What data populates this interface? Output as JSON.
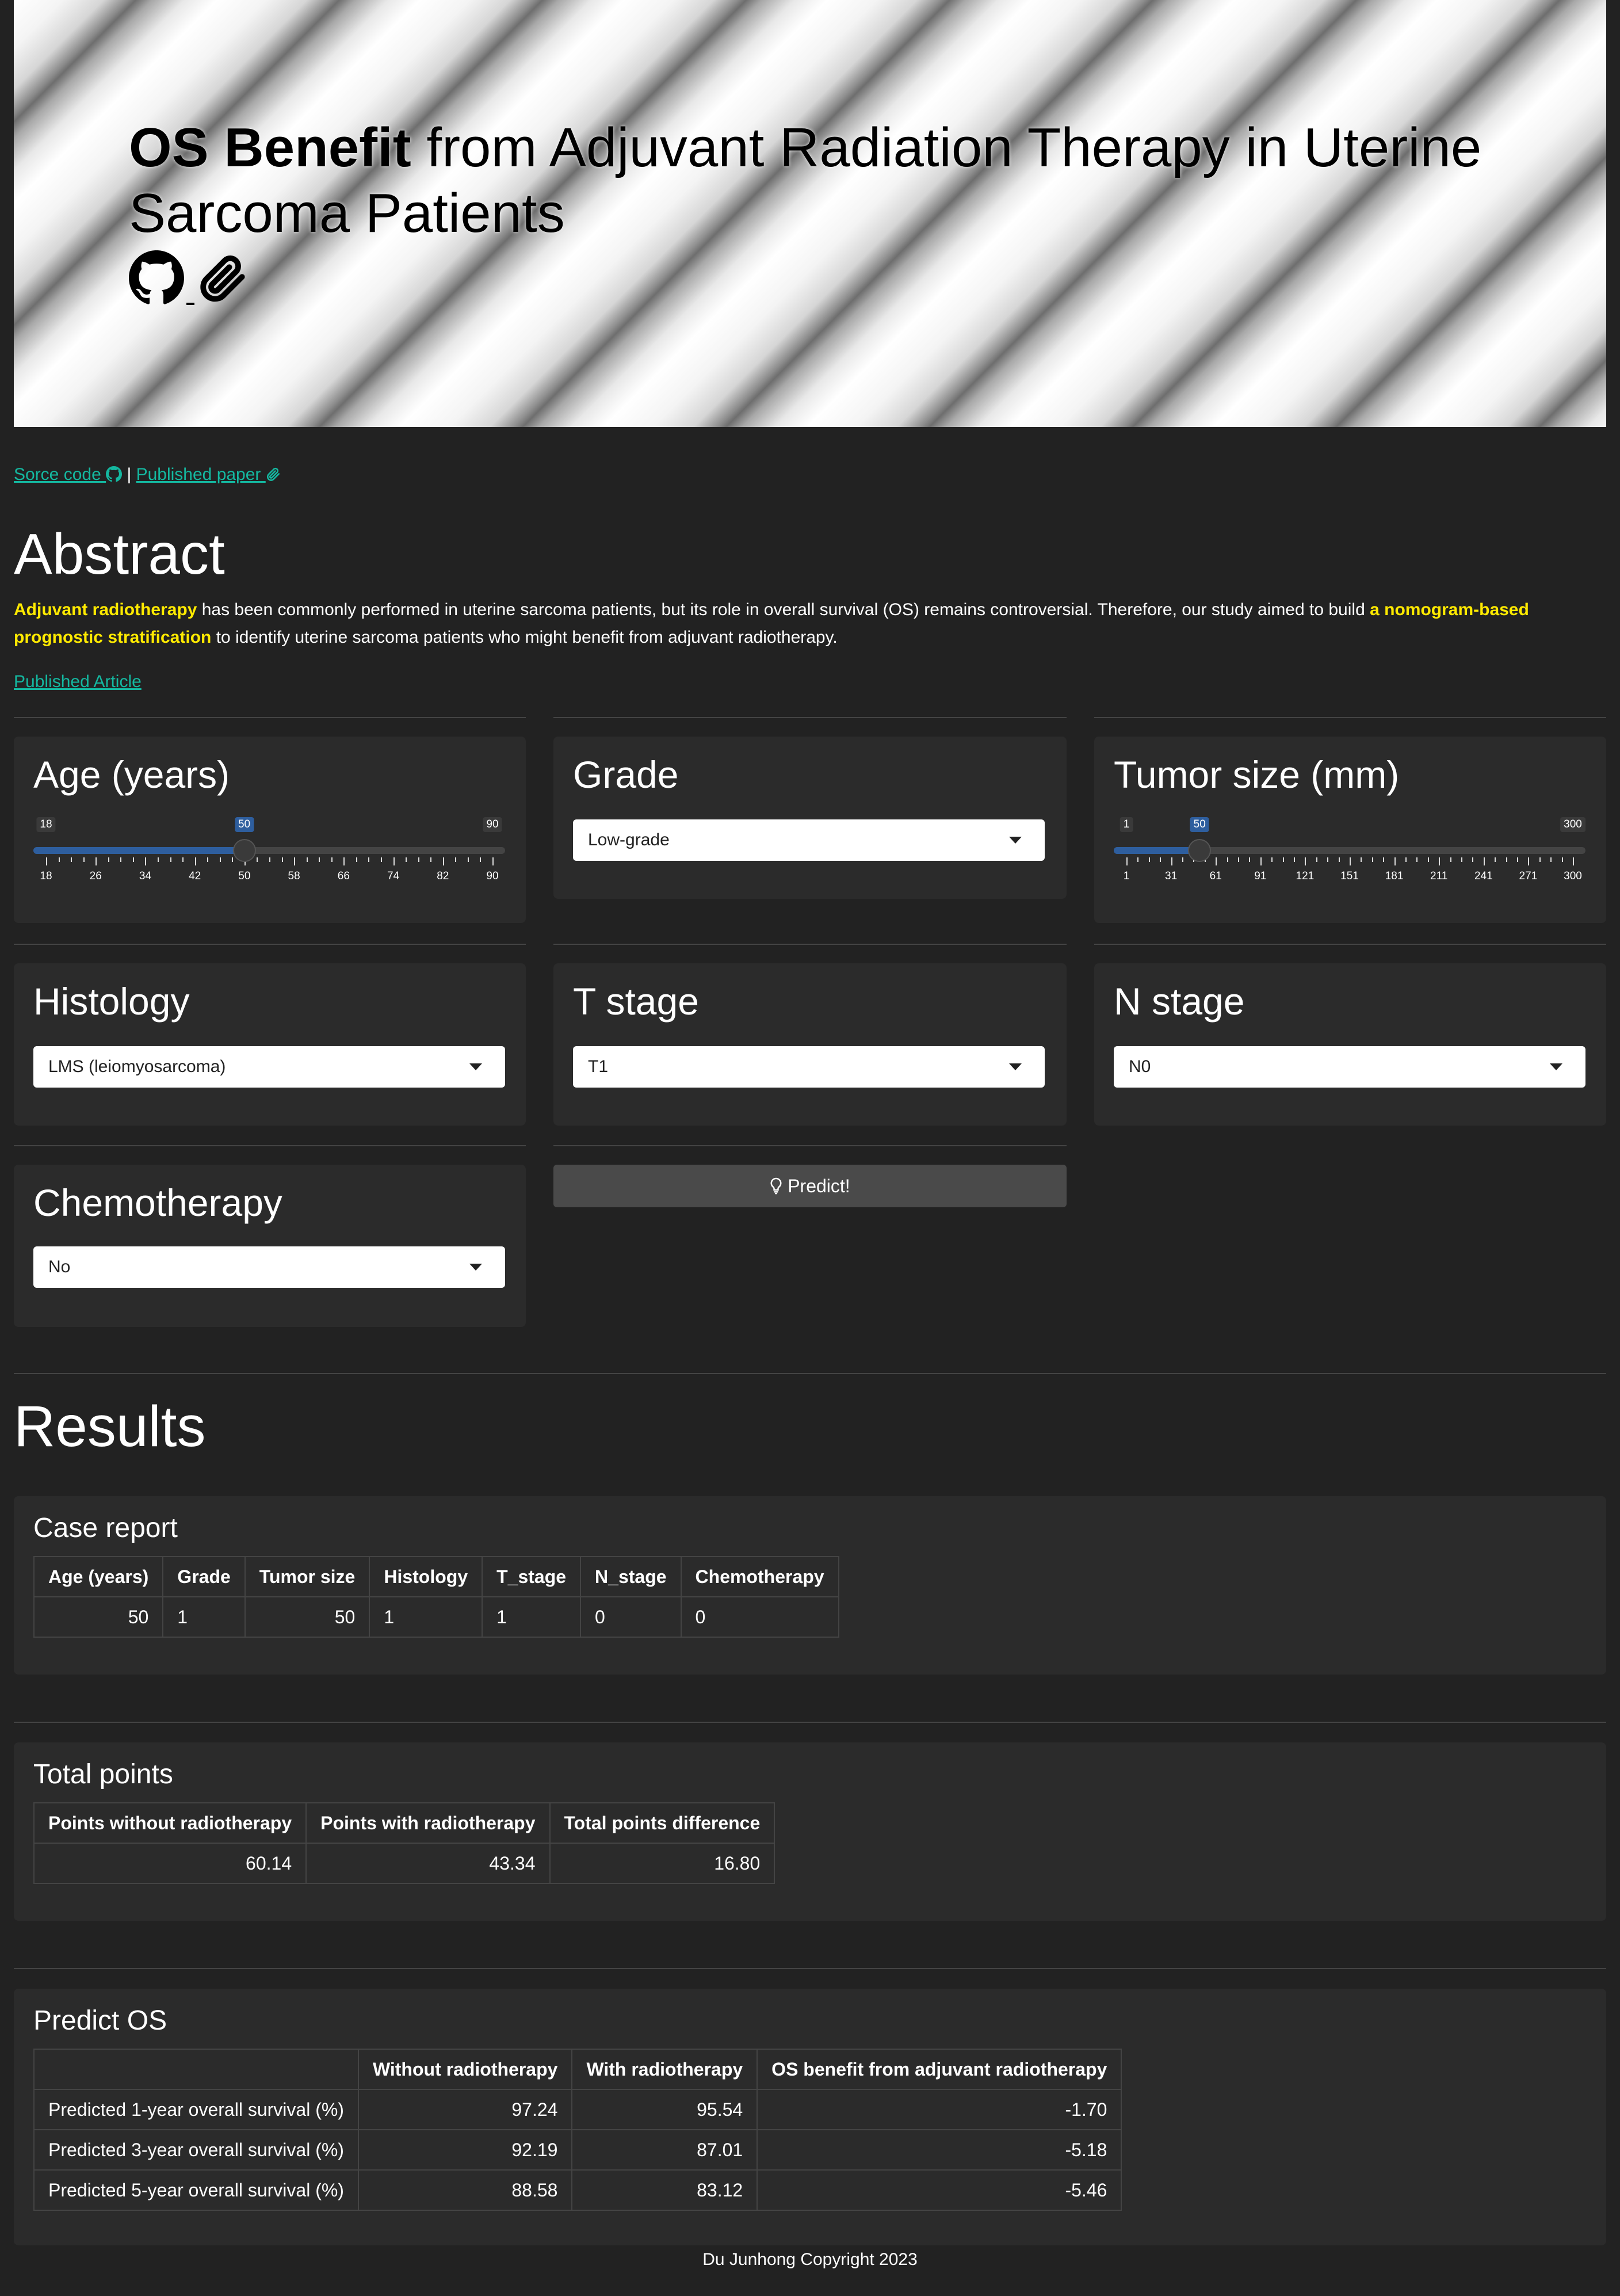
{
  "hero": {
    "title_bold": "OS Benefit",
    "title_rest": " from Adjuvant Radiation Therapy in Uterine Sarcoma Patients",
    "github_icon": "github-icon",
    "paperclip_icon": "paperclip-icon"
  },
  "links": {
    "source_code": "Sorce code",
    "separator": "|",
    "published_paper": "Published paper"
  },
  "abstract": {
    "heading": "Abstract",
    "hl1": "Adjuvant radiotherapy",
    "text1": " has been commonly performed in uterine sarcoma patients, but its role in overall survival (OS) remains controversial. Therefore, our study aimed to build ",
    "hl2": "a nomogram-based prognostic stratification",
    "text2": " to identify uterine sarcoma patients who might benefit from adjuvant radiotherapy.",
    "published_article": "Published Article"
  },
  "inputs": {
    "age": {
      "label": "Age (years)",
      "min": "18",
      "max": "90",
      "value": "50",
      "fraction": 0.444,
      "ticks": [
        "18",
        "26",
        "34",
        "42",
        "50",
        "58",
        "66",
        "74",
        "82",
        "90"
      ]
    },
    "grade": {
      "label": "Grade",
      "value": "Low-grade"
    },
    "tumor_size": {
      "label": "Tumor size (mm)",
      "min": "1",
      "max": "300",
      "value": "50",
      "fraction": 0.164,
      "ticks": [
        "1",
        "31",
        "61",
        "91",
        "121",
        "151",
        "181",
        "211",
        "241",
        "271",
        "300"
      ]
    },
    "histology": {
      "label": "Histology",
      "value": "LMS (leiomyosarcoma)"
    },
    "t_stage": {
      "label": "T stage",
      "value": "T1"
    },
    "n_stage": {
      "label": "N stage",
      "value": "N0"
    },
    "chemotherapy": {
      "label": "Chemotherapy",
      "value": "No"
    },
    "predict_label": "Predict!",
    "predict_icon": "lightbulb-icon"
  },
  "results": {
    "heading": "Results",
    "case_report": {
      "title": "Case report",
      "headers": [
        "Age (years)",
        "Grade",
        "Tumor size",
        "Histology",
        "T_stage",
        "N_stage",
        "Chemotherapy"
      ],
      "row": [
        "50",
        "1",
        "50",
        "1",
        "1",
        "0",
        "0"
      ]
    },
    "total_points": {
      "title": "Total points",
      "headers": [
        "Points without radiotherapy",
        "Points with radiotherapy",
        "Total points difference"
      ],
      "row": [
        "60.14",
        "43.34",
        "16.80"
      ]
    },
    "predict_os": {
      "title": "Predict OS",
      "headers": [
        "",
        "Without radiotherapy",
        "With radiotherapy",
        "OS benefit from adjuvant radiotherapy"
      ],
      "rows": [
        [
          "Predicted 1-year overall survival (%)",
          "97.24",
          "95.54",
          "-1.70"
        ],
        [
          "Predicted 3-year overall survival (%)",
          "92.19",
          "87.01",
          "-5.18"
        ],
        [
          "Predicted 5-year overall survival (%)",
          "88.58",
          "83.12",
          "-5.46"
        ]
      ]
    }
  },
  "footer": "Du Junhong Copyright 2023"
}
